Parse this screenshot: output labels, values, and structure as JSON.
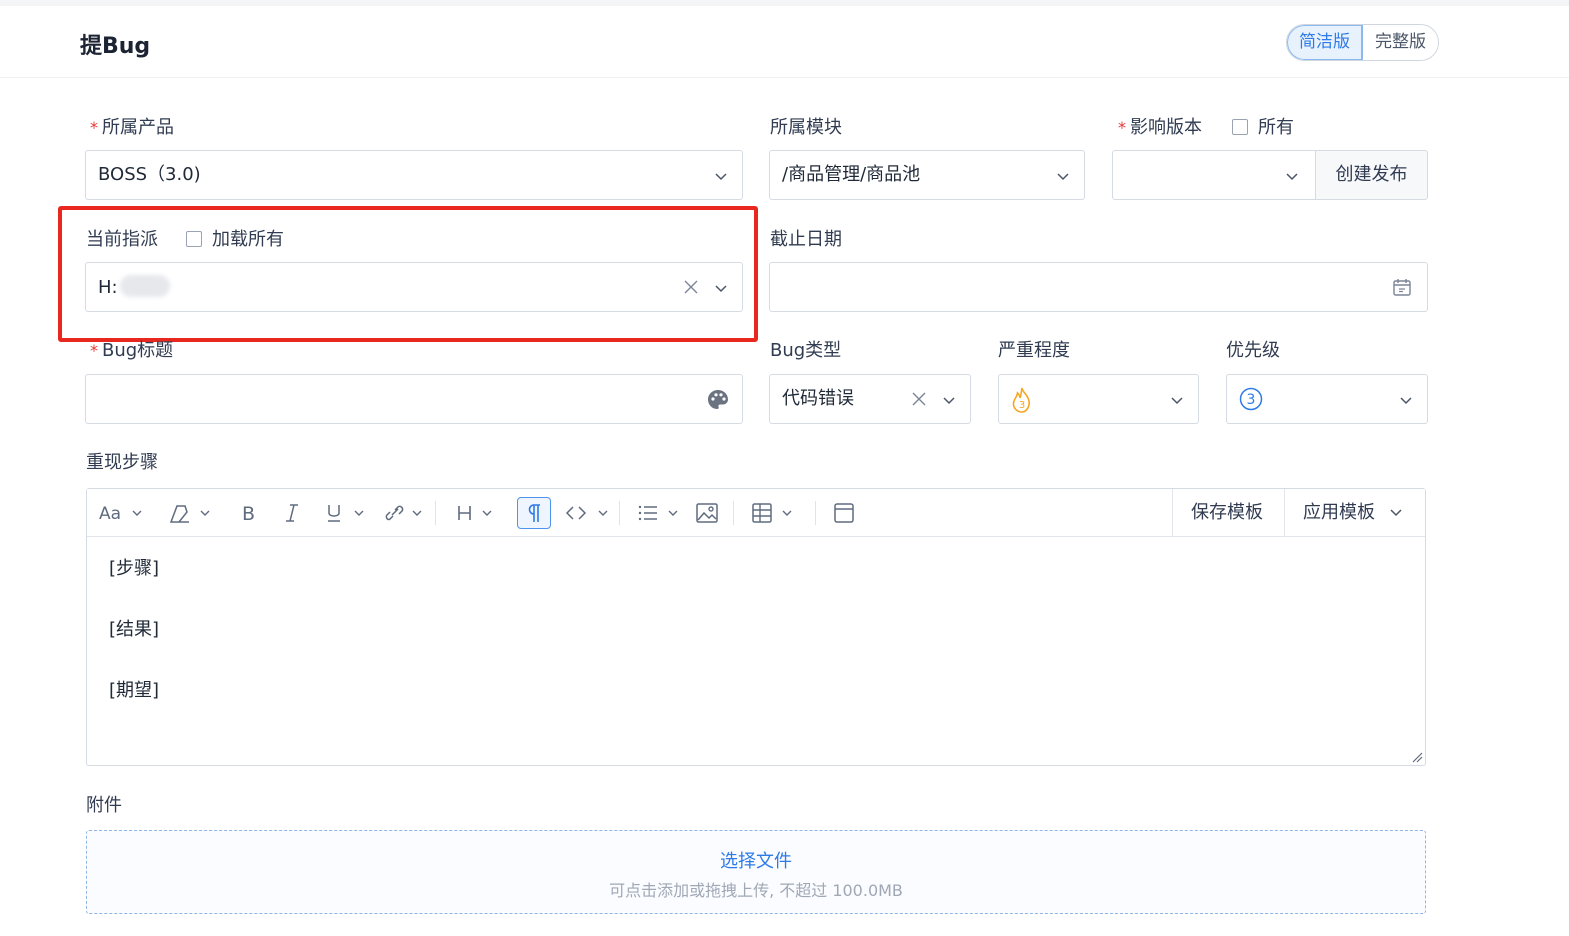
{
  "header": {
    "title": "提Bug",
    "modes": [
      "简洁版",
      "完整版"
    ],
    "active_mode": "简洁版"
  },
  "form": {
    "product": {
      "label": "所属产品",
      "required": true,
      "value": "BOSS（3.0)"
    },
    "module": {
      "label": "所属模块",
      "value": "/商品管理/商品池"
    },
    "version": {
      "label": "影响版本",
      "required": true,
      "all_label": "所有",
      "value": "",
      "create_label": "创建发布"
    },
    "assignee": {
      "label": "当前指派",
      "load_all_label": "加载所有",
      "value": "H:"
    },
    "deadline": {
      "label": "截止日期",
      "value": ""
    },
    "bug_title": {
      "label": "Bug标题",
      "required": true,
      "value": ""
    },
    "bug_type": {
      "label": "Bug类型",
      "value": "代码错误"
    },
    "severity": {
      "label": "严重程度",
      "value": "3"
    },
    "priority": {
      "label": "优先级",
      "value": "3"
    },
    "steps": {
      "label": "重现步骤",
      "save_template": "保存模板",
      "apply_template": "应用模板",
      "content": [
        "[步骤]",
        "[结果]",
        "[期望]"
      ]
    },
    "attachment": {
      "label": "附件",
      "choose": "选择文件",
      "hint": "可点击添加或拖拽上传, 不超过 100.0MB"
    }
  },
  "colors": {
    "accent": "#2e7ae6",
    "highlight": "#e8281e",
    "required": "#e53935",
    "severity": "#f5a623"
  }
}
